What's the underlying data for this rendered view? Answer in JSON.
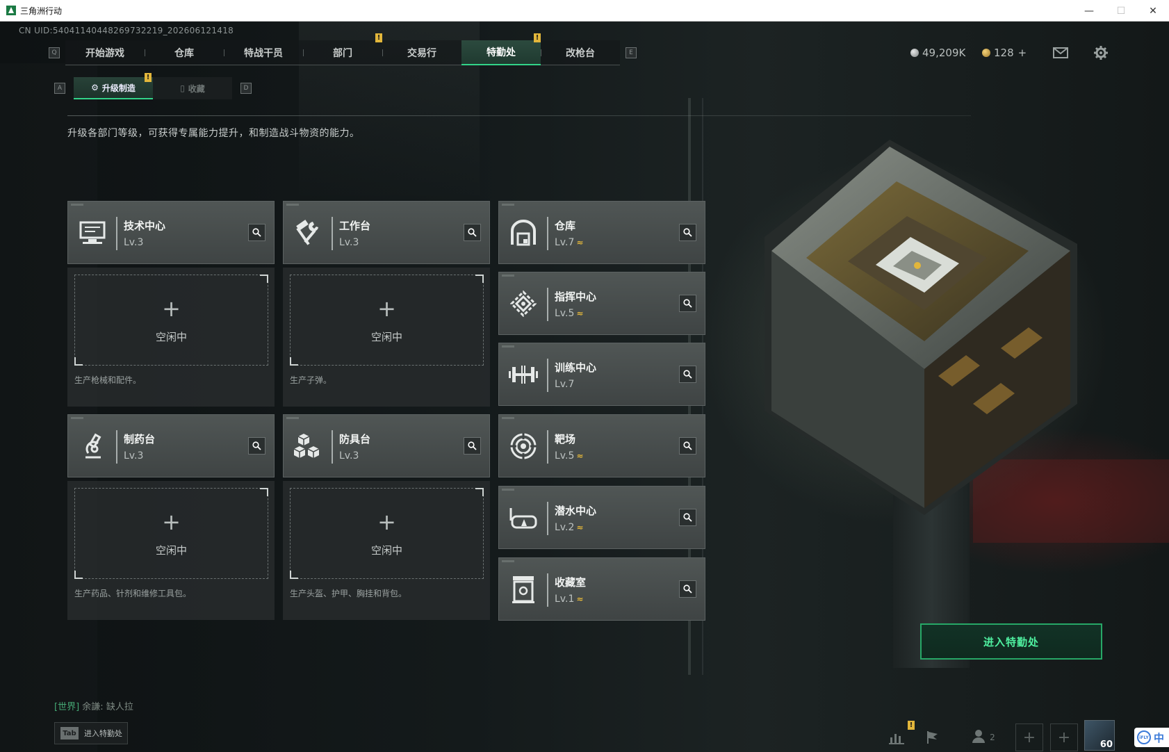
{
  "window": {
    "title": "三角洲行动",
    "min": "—",
    "max": "☐",
    "close": "✕"
  },
  "uid": "CN UID:540411404482697322​19_202606121418",
  "main_nav": {
    "left_key": "Q",
    "right_key": "E",
    "tabs": [
      {
        "label": "开始游戏"
      },
      {
        "label": "仓库"
      },
      {
        "label": "特战干员"
      },
      {
        "label": "部门"
      },
      {
        "label": "交易行"
      },
      {
        "label": "特勤处"
      },
      {
        "label": "改枪台"
      }
    ],
    "badge": "!"
  },
  "sub_nav": {
    "left_key": "A",
    "right_key": "D",
    "tabs": [
      {
        "label": "升级制造"
      },
      {
        "label": "收藏"
      }
    ],
    "badge": "!"
  },
  "description": "升级各部门等级，可获得专属能力提升，和制造战斗物资的能力。",
  "currency": {
    "silver": "49,209K",
    "gold": "128",
    "gold_add": "+"
  },
  "idle_text": "空闲中",
  "plus": "+",
  "production": [
    {
      "name": "技术中心",
      "level": "Lv.3",
      "icon": "computer-icon",
      "desc": "生产枪械和配件。"
    },
    {
      "name": "工作台",
      "level": "Lv.3",
      "icon": "hammer-wrench-icon",
      "desc": "生产子弹。"
    },
    {
      "name": "制药台",
      "level": "Lv.3",
      "icon": "microscope-icon",
      "desc": "生产药品、针剂和维修工具包。"
    },
    {
      "name": "防具台",
      "level": "Lv.3",
      "icon": "cubes-icon",
      "desc": "生产头盔、护甲、胸挂和背包。"
    }
  ],
  "facilities": [
    {
      "name": "仓库",
      "level": "Lv.7",
      "upgrade": "≈",
      "icon": "warehouse-icon"
    },
    {
      "name": "指挥中心",
      "level": "Lv.5",
      "upgrade": "≈",
      "icon": "command-icon"
    },
    {
      "name": "训练中心",
      "level": "Lv.7",
      "upgrade": "",
      "icon": "dumbbell-icon"
    },
    {
      "name": "靶场",
      "level": "Lv.5",
      "upgrade": "≈",
      "icon": "target-icon"
    },
    {
      "name": "潜水中心",
      "level": "Lv.2",
      "upgrade": "≈",
      "icon": "dive-mask-icon"
    },
    {
      "name": "收藏室",
      "level": "Lv.1",
      "upgrade": "≈",
      "icon": "collection-icon"
    }
  ],
  "enter_button": "进入特勤处",
  "chat": {
    "channel": "[世界]",
    "user": "余謙:",
    "message": "缺人拉"
  },
  "tab_hint": {
    "key": "Tab",
    "label": "进入特勤处"
  },
  "bottom_bar": {
    "friends_count": "2",
    "player_level": "60"
  },
  "ime": {
    "logo": "iFLY",
    "lang": "中"
  },
  "colors": {
    "accent": "#32d489",
    "badge": "#e2b63b",
    "enter_border": "#27a867"
  }
}
